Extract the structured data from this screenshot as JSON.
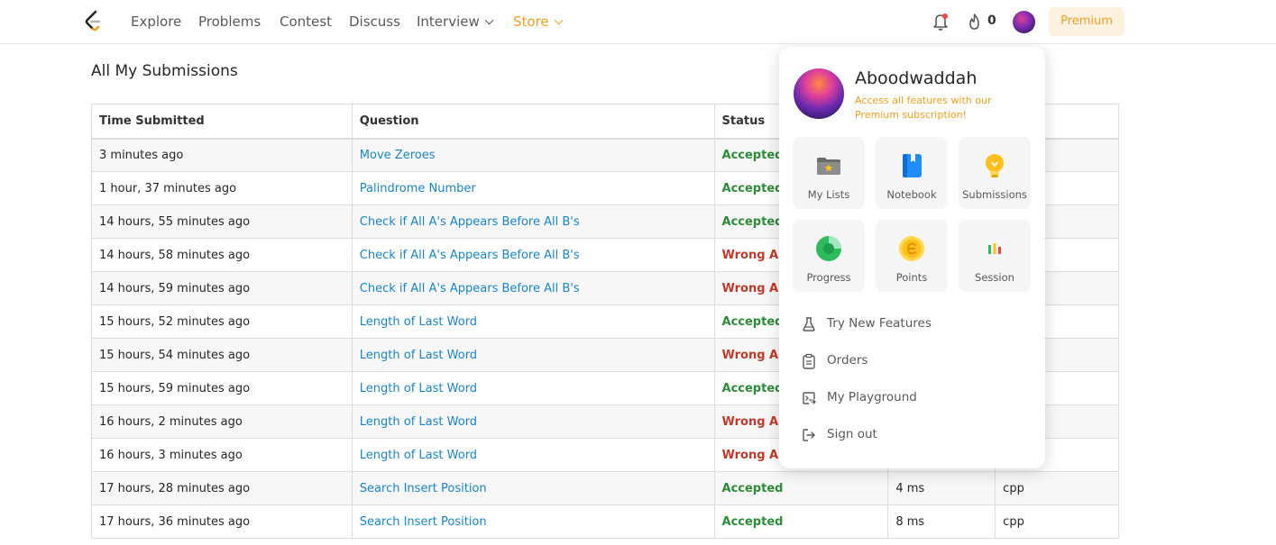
{
  "nav": {
    "links": [
      "Explore",
      "Problems",
      "Contest",
      "Discuss",
      "Interview",
      "Store"
    ],
    "streak_count": "0",
    "premium_label": "Premium"
  },
  "page": {
    "title": "All My Submissions"
  },
  "table": {
    "headers": [
      "Time Submitted",
      "Question",
      "Status",
      "",
      "Language"
    ],
    "visible_headers": [
      "Time Submitted",
      "Question",
      "Status",
      "ge"
    ],
    "rows": [
      {
        "time": "3 minutes ago",
        "question": "Move Zeroes",
        "status": "Accepted",
        "runtime": "",
        "lang": ""
      },
      {
        "time": "1 hour, 37 minutes ago",
        "question": "Palindrome Number",
        "status": "Accepted",
        "runtime": "",
        "lang": ""
      },
      {
        "time": "14 hours, 55 minutes ago",
        "question": "Check if All A's Appears Before All B's",
        "status": "Accepted",
        "runtime": "",
        "lang": ""
      },
      {
        "time": "14 hours, 58 minutes ago",
        "question": "Check if All A's Appears Before All B's",
        "status": "Wrong An",
        "runtime": "",
        "lang": ""
      },
      {
        "time": "14 hours, 59 minutes ago",
        "question": "Check if All A's Appears Before All B's",
        "status": "Wrong An",
        "runtime": "",
        "lang": ""
      },
      {
        "time": "15 hours, 52 minutes ago",
        "question": "Length of Last Word",
        "status": "Accepted",
        "runtime": "",
        "lang": ""
      },
      {
        "time": "15 hours, 54 minutes ago",
        "question": "Length of Last Word",
        "status": "Wrong An",
        "runtime": "",
        "lang": ""
      },
      {
        "time": "15 hours, 59 minutes ago",
        "question": "Length of Last Word",
        "status": "Accepted",
        "runtime": "",
        "lang": ""
      },
      {
        "time": "16 hours, 2 minutes ago",
        "question": "Length of Last Word",
        "status": "Wrong An",
        "runtime": "",
        "lang": ""
      },
      {
        "time": "16 hours, 3 minutes ago",
        "question": "Length of Last Word",
        "status": "Wrong An",
        "runtime": "",
        "lang": ""
      },
      {
        "time": "17 hours, 28 minutes ago",
        "question": "Search Insert Position",
        "status": "Accepted",
        "runtime": "4 ms",
        "lang": "cpp"
      },
      {
        "time": "17 hours, 36 minutes ago",
        "question": "Search Insert Position",
        "status": "Accepted",
        "runtime": "8 ms",
        "lang": "cpp"
      }
    ]
  },
  "profile_menu": {
    "username": "Aboodwaddah",
    "subtitle": "Access all features with our Premium subscription!",
    "tiles": [
      {
        "label": "My Lists",
        "icon": "folder-star-icon"
      },
      {
        "label": "Notebook",
        "icon": "notebook-icon"
      },
      {
        "label": "Submissions",
        "icon": "lightbulb-icon"
      },
      {
        "label": "Progress",
        "icon": "progress-icon"
      },
      {
        "label": "Points",
        "icon": "points-coin-icon"
      },
      {
        "label": "Session",
        "icon": "session-chart-icon"
      }
    ],
    "items": [
      {
        "label": "Try New Features",
        "icon": "flask-icon"
      },
      {
        "label": "Orders",
        "icon": "clipboard-icon"
      },
      {
        "label": "My Playground",
        "icon": "terminal-icon"
      },
      {
        "label": "Sign out",
        "icon": "sign-out-icon"
      }
    ]
  },
  "colors": {
    "accent": "#f0a020",
    "link": "#1a84c8",
    "accepted": "#2e8b3a",
    "wrong": "#c0392b"
  }
}
